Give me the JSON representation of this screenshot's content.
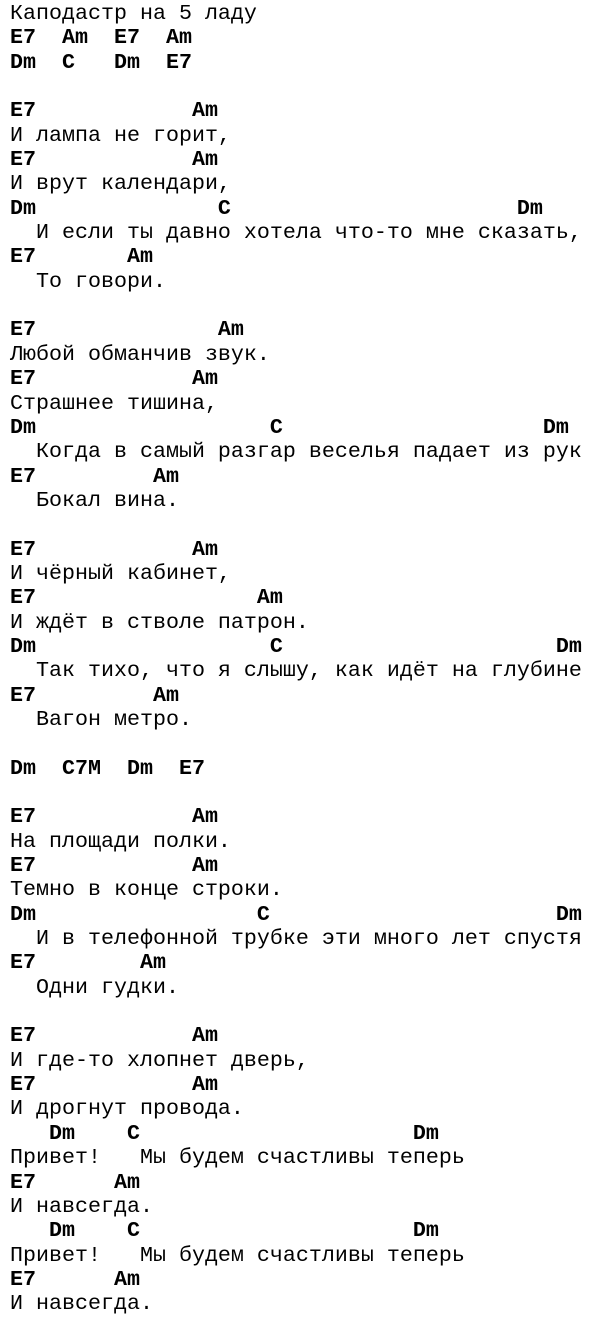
{
  "song": {
    "lines": [
      {
        "type": "text",
        "text": "Каподастр на 5 ладу"
      },
      {
        "type": "chord",
        "text": "E7  Am  E7  Am"
      },
      {
        "type": "chord",
        "text": "Dm  C   Dm  E7"
      },
      {
        "type": "blank",
        "text": ""
      },
      {
        "type": "chord",
        "text": "E7            Am"
      },
      {
        "type": "lyric",
        "text": "И лампа не горит,"
      },
      {
        "type": "chord",
        "text": "E7            Am"
      },
      {
        "type": "lyric",
        "text": "И врут календари,"
      },
      {
        "type": "chord",
        "text": "Dm              C                      Dm"
      },
      {
        "type": "lyric",
        "text": "  И если ты давно хотела что-то мне сказать,"
      },
      {
        "type": "chord",
        "text": "E7       Am"
      },
      {
        "type": "lyric",
        "text": "  То говори."
      },
      {
        "type": "blank",
        "text": ""
      },
      {
        "type": "chord",
        "text": "E7              Am"
      },
      {
        "type": "lyric",
        "text": "Любой обманчив звук."
      },
      {
        "type": "chord",
        "text": "E7            Am"
      },
      {
        "type": "lyric",
        "text": "Страшнее тишина,"
      },
      {
        "type": "chord",
        "text": "Dm                  C                    Dm"
      },
      {
        "type": "lyric",
        "text": "  Когда в самый разгар веселья падает из рук"
      },
      {
        "type": "chord",
        "text": "E7         Am"
      },
      {
        "type": "lyric",
        "text": "  Бокал вина."
      },
      {
        "type": "blank",
        "text": ""
      },
      {
        "type": "chord",
        "text": "E7            Am"
      },
      {
        "type": "lyric",
        "text": "И чёрный кабинет,"
      },
      {
        "type": "chord",
        "text": "E7                 Am"
      },
      {
        "type": "lyric",
        "text": "И ждёт в стволе патрон."
      },
      {
        "type": "chord",
        "text": "Dm                  C                     Dm"
      },
      {
        "type": "lyric",
        "text": "  Так тихо, что я слышу, как идёт на глубине"
      },
      {
        "type": "chord",
        "text": "E7         Am"
      },
      {
        "type": "lyric",
        "text": "  Вагон метро."
      },
      {
        "type": "blank",
        "text": ""
      },
      {
        "type": "chord",
        "text": "Dm  C7M  Dm  E7"
      },
      {
        "type": "blank",
        "text": ""
      },
      {
        "type": "chord",
        "text": "E7            Am"
      },
      {
        "type": "lyric",
        "text": "На площади полки."
      },
      {
        "type": "chord",
        "text": "E7            Am"
      },
      {
        "type": "lyric",
        "text": "Темно в конце строки."
      },
      {
        "type": "chord",
        "text": "Dm                 C                      Dm"
      },
      {
        "type": "lyric",
        "text": "  И в телефонной трубке эти много лет спустя"
      },
      {
        "type": "chord",
        "text": "E7        Am"
      },
      {
        "type": "lyric",
        "text": "  Одни гудки."
      },
      {
        "type": "blank",
        "text": ""
      },
      {
        "type": "chord",
        "text": "E7            Am"
      },
      {
        "type": "lyric",
        "text": "И где-то хлопнет дверь,"
      },
      {
        "type": "chord",
        "text": "E7            Am"
      },
      {
        "type": "lyric",
        "text": "И дрогнут провода."
      },
      {
        "type": "chord",
        "text": "   Dm    C                     Dm"
      },
      {
        "type": "lyric",
        "text": "Привет!   Мы будем счастливы теперь"
      },
      {
        "type": "chord",
        "text": "E7      Am"
      },
      {
        "type": "lyric",
        "text": "И навсегда."
      },
      {
        "type": "chord",
        "text": "   Dm    C                     Dm"
      },
      {
        "type": "lyric",
        "text": "Привет!   Мы будем счастливы теперь"
      },
      {
        "type": "chord",
        "text": "E7      Am"
      },
      {
        "type": "lyric",
        "text": "И навсегда."
      }
    ]
  }
}
